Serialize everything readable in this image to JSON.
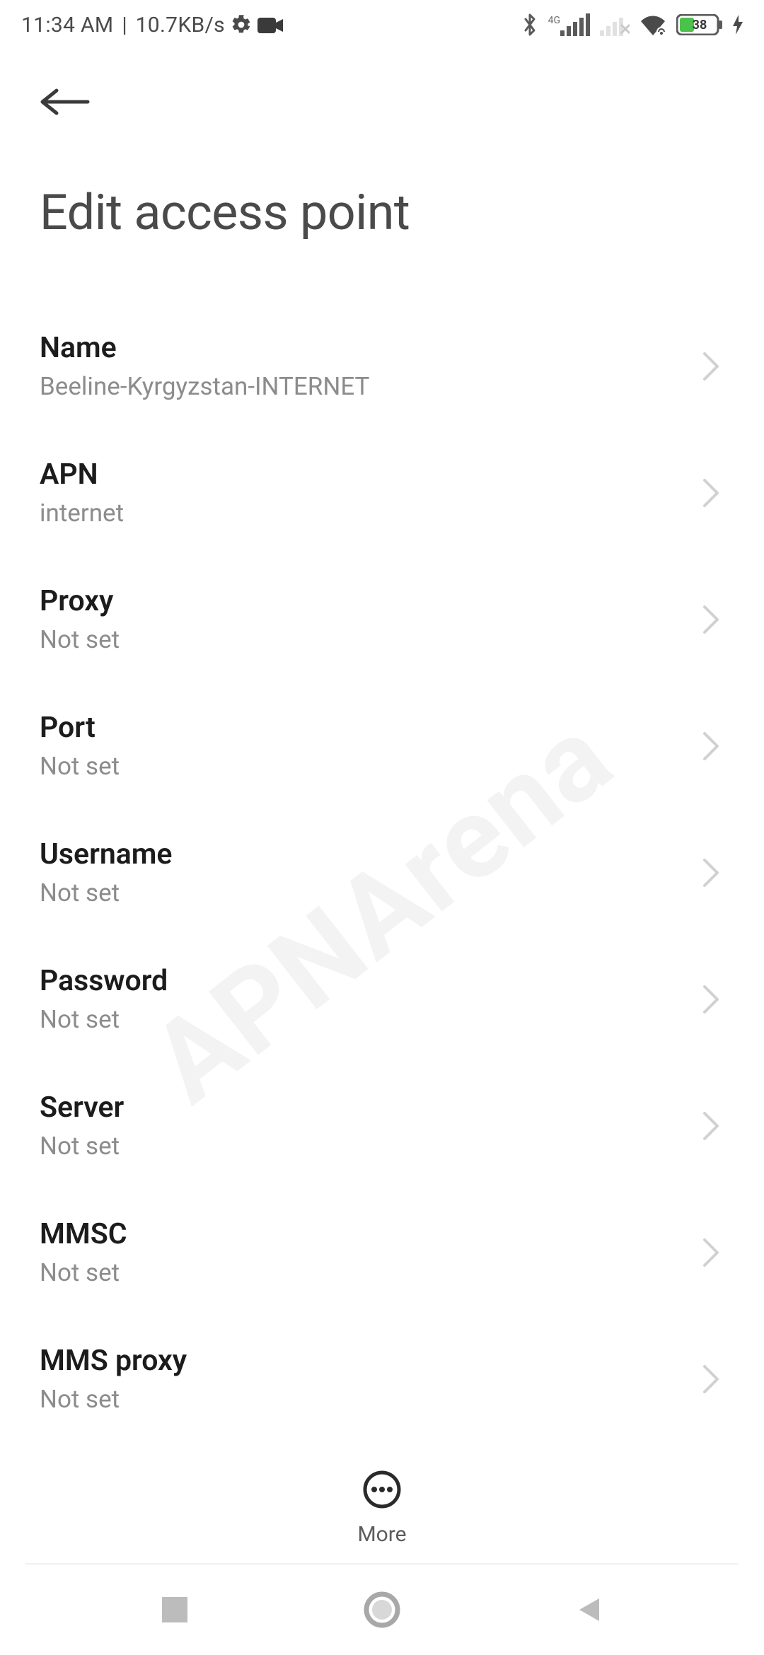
{
  "status_bar": {
    "time": "11:34 AM",
    "divider": "|",
    "net_speed": "10.7KB/s",
    "battery_percent": "38",
    "mobile_gen": "4G"
  },
  "header": {
    "title": "Edit access point"
  },
  "rows": [
    {
      "label": "Name",
      "value": "Beeline-Kyrgyzstan-INTERNET"
    },
    {
      "label": "APN",
      "value": "internet"
    },
    {
      "label": "Proxy",
      "value": "Not set"
    },
    {
      "label": "Port",
      "value": "Not set"
    },
    {
      "label": "Username",
      "value": "Not set"
    },
    {
      "label": "Password",
      "value": "Not set"
    },
    {
      "label": "Server",
      "value": "Not set"
    },
    {
      "label": "MMSC",
      "value": "Not set"
    },
    {
      "label": "MMS proxy",
      "value": "Not set"
    }
  ],
  "more": {
    "label": "More"
  },
  "watermark": "APNArena"
}
